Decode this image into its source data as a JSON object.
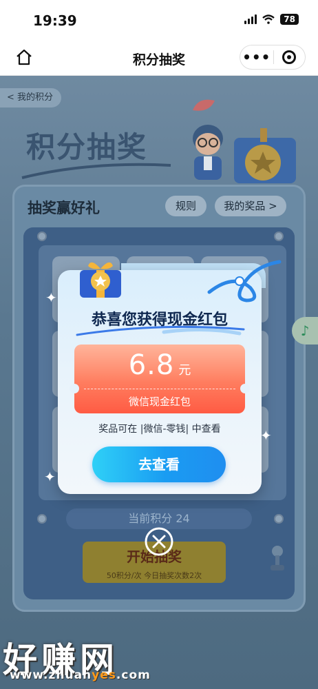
{
  "status_bar": {
    "time": "19:39",
    "battery": "78"
  },
  "nav": {
    "title": "积分抽奖"
  },
  "page": {
    "back_label": "< 我的积分",
    "hero_title": "积分抽奖",
    "panel_title": "抽奖赢好礼",
    "rules_label": "规则",
    "my_prizes_label": "我的奖品 >",
    "points_label": "当前积分",
    "points_value": "24",
    "start_label": "开始抽奖",
    "start_sub": "50积分/次  今日抽奖次数2次"
  },
  "modal": {
    "title": "恭喜您获得现金红包",
    "amount": "6.8",
    "unit": "元",
    "reward_type": "微信现金红包",
    "note": "奖品可在 |微信-零钱| 中查看",
    "button_label": "去查看"
  },
  "watermark": {
    "main": "好赚网",
    "url_prefix": "www.zhuan",
    "url_accent": "yes",
    "url_suffix": ".com"
  },
  "colors": {
    "button_blue": "#1a9cf2",
    "ticket_red": "#ff5b43",
    "modal_title": "#0f2850"
  }
}
